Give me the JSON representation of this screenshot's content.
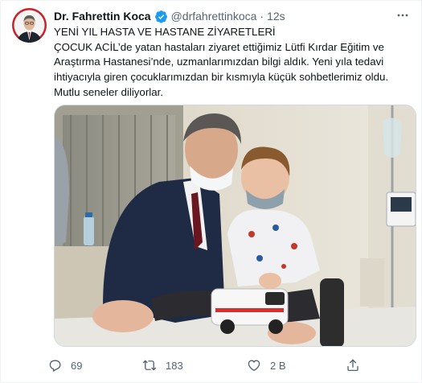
{
  "author": {
    "name": "Dr. Fahrettin Koca",
    "handle": "@drfahrettinkoca",
    "separator": "·",
    "time": "12s"
  },
  "tweet": {
    "headline": "YENİ YIL HASTA VE HASTANE ZİYARETLERİ",
    "body": "ÇOCUK ACİL’de yatan hastaları ziyaret ettiğimiz Lütfi Kırdar Eğitim ve Araştırma Hastanesi’nde, uzmanlarımızdan bilgi aldık. Yeni yıla tedavi ihtiyacıyla giren çocuklarımızdan bir kısmıyla küçük sohbetlerimiz oldu. Mutlu seneler diliyorlar."
  },
  "actions": {
    "reply_count": "69",
    "retweet_count": "183",
    "like_count": "2 B"
  },
  "icons": [
    "verified-badge-icon",
    "more-options-icon",
    "reply-icon",
    "retweet-icon",
    "like-icon",
    "share-icon"
  ],
  "colors": {
    "verified": "#1d9bf0",
    "secondary_text": "#536471",
    "primary_text": "#0f1419"
  }
}
